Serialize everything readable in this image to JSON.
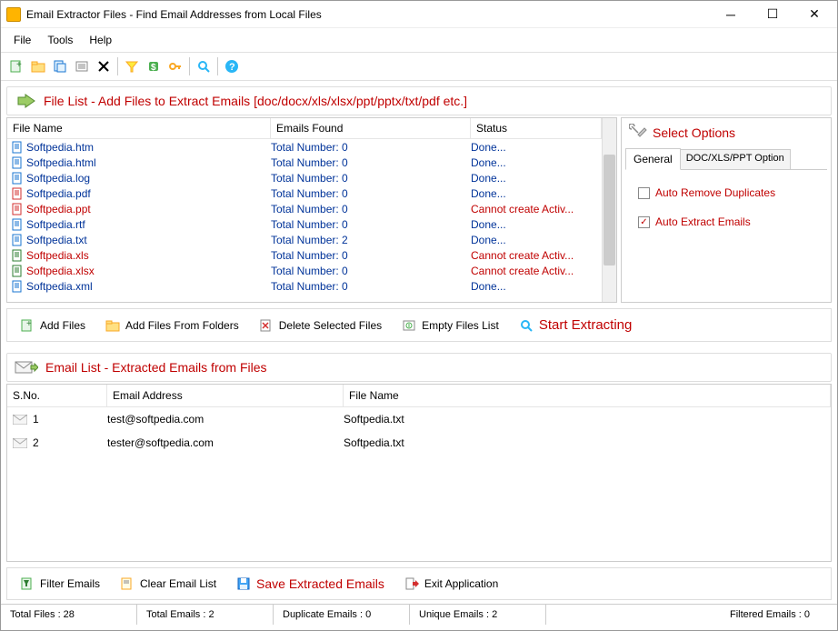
{
  "window": {
    "title": "Email Extractor Files -  Find Email Addresses from Local Files"
  },
  "menu": {
    "file": "File",
    "tools": "Tools",
    "help": "Help"
  },
  "section1_title": "File List - Add Files to Extract Emails [doc/docx/xls/xlsx/ppt/pptx/txt/pdf etc.]",
  "filelist": {
    "cols": {
      "fname": "File Name",
      "emails": "Emails Found",
      "status": "Status"
    },
    "rows": [
      {
        "name": "Softpedia.htm",
        "emails": "Total Number: 0",
        "status": "Done...",
        "type": "doc"
      },
      {
        "name": "Softpedia.html",
        "emails": "Total Number: 0",
        "status": "Done...",
        "type": "doc"
      },
      {
        "name": "Softpedia.log",
        "emails": "Total Number: 0",
        "status": "Done...",
        "type": "doc"
      },
      {
        "name": "Softpedia.pdf",
        "emails": "Total Number: 0",
        "status": "Done...",
        "type": "pdf"
      },
      {
        "name": "Softpedia.ppt",
        "emails": "Total Number: 0",
        "status": "Cannot create Activ...",
        "type": "ppt"
      },
      {
        "name": "Softpedia.rtf",
        "emails": "Total Number: 0",
        "status": "Done...",
        "type": "doc"
      },
      {
        "name": "Softpedia.txt",
        "emails": "Total Number: 2",
        "status": "Done...",
        "type": "doc"
      },
      {
        "name": "Softpedia.xls",
        "emails": "Total Number: 0",
        "status": "Cannot create Activ...",
        "type": "xls"
      },
      {
        "name": "Softpedia.xlsx",
        "emails": "Total Number: 0",
        "status": "Cannot create Activ...",
        "type": "xls"
      },
      {
        "name": "Softpedia.xml",
        "emails": "Total Number: 0",
        "status": "Done...",
        "type": "doc"
      }
    ]
  },
  "options": {
    "title": "Select Options",
    "tab_general": "General",
    "tab_doc": "DOC/XLS/PPT Option",
    "cb_dup": "Auto Remove Duplicates",
    "cb_extract": "Auto Extract Emails"
  },
  "actions": {
    "add_files": "Add Files",
    "add_folders": "Add Files From Folders",
    "delete_sel": "Delete Selected Files",
    "empty": "Empty Files List",
    "start": "Start Extracting"
  },
  "section2_title": "Email List - Extracted Emails from Files",
  "emaillist": {
    "cols": {
      "sno": "S.No.",
      "email": "Email Address",
      "fname": "File Name"
    },
    "rows": [
      {
        "n": "1",
        "email": "test@softpedia.com",
        "fname": "Softpedia.txt"
      },
      {
        "n": "2",
        "email": "tester@softpedia.com",
        "fname": "Softpedia.txt"
      }
    ]
  },
  "bottom_actions": {
    "filter": "Filter Emails",
    "clear": "Clear Email List",
    "save": "Save Extracted Emails",
    "exit": "Exit Application"
  },
  "status": {
    "total_files": "Total Files :  28",
    "total_emails": "Total Emails :  2",
    "dup_emails": "Duplicate Emails :  0",
    "unique_emails": "Unique Emails :  2",
    "filtered": "Filtered Emails :  0"
  }
}
